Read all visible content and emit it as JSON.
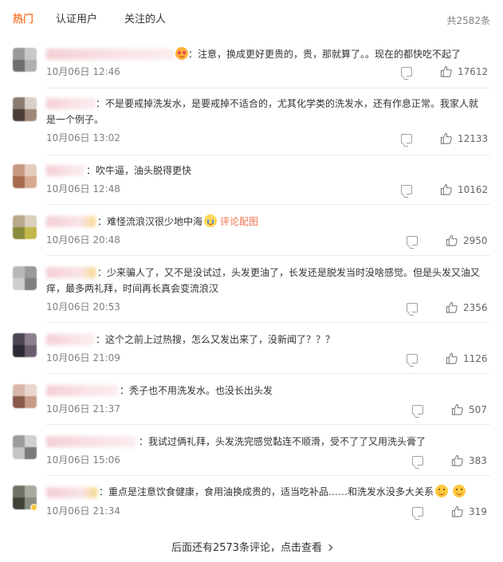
{
  "tabs": [
    {
      "label": "热门",
      "active": true
    },
    {
      "label": "认证用户",
      "active": false
    },
    {
      "label": "关注的人",
      "active": false
    }
  ],
  "total": "共2582条",
  "comments": [
    {
      "text": "：注意，换成更好更贵的，贵，那就算了。。现在的都快吃不起了",
      "time": "10月06日 12:46",
      "likes": "17612",
      "emoji_before": "eyes"
    },
    {
      "text": "：不是要戒掉洗发水，是要戒掉不适合的，尤其化学类的洗发水，还有作息正常。我家人就是一个例子。",
      "time": "10月06日 13:02",
      "likes": "12133"
    },
    {
      "text": "：吹牛逼，油头脱得更快",
      "time": "10月06日 12:48",
      "likes": "10162"
    },
    {
      "text": "：难怪流浪汉很少地中海",
      "time": "10月06日 20:48",
      "likes": "2950",
      "emoji_after": "cry",
      "pic_link": "评论配图"
    },
    {
      "text": "：少来骗人了，又不是没试过，头发更油了，长发还是脱发当时没啥感觉。但是头发又油又痒，最多两礼拜，时间再长真会变流浪汉",
      "time": "10月06日 20:53",
      "likes": "2356"
    },
    {
      "text": "：这个之前上过热搜，怎么又发出来了，没新闻了？？？",
      "time": "10月06日 21:09",
      "likes": "1126"
    },
    {
      "text": "：秃子也不用洗发水。也没长出头发",
      "time": "10月06日 21:37",
      "likes": "507"
    },
    {
      "text": "：我试过俩礼拜，头发洗完感觉黏连不顺滑，受不了了又用洗头膏了",
      "time": "10月06日 15:06",
      "likes": "383"
    },
    {
      "text": "：重点是注意饮食健康，食用油换成贵的，适当吃补品……和洗发水没多大关系",
      "time": "10月06日 21:34",
      "likes": "319",
      "emoji_after_double": true
    }
  ],
  "more_label": "后面还有2573条评论，点击查看",
  "colors": {
    "accent": "#fa7d3c",
    "pic_link": "#eb7350",
    "muted": "#808080"
  },
  "icons": {
    "reply": "comment-icon",
    "like": "thumb-up-icon",
    "more": "chevron-right-icon"
  }
}
